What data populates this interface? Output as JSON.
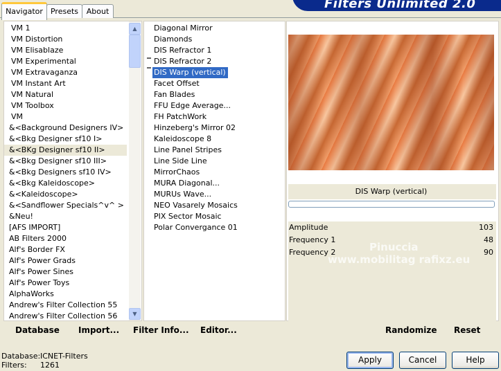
{
  "tabs": [
    {
      "label": "Navigator",
      "active": true
    },
    {
      "label": "Presets",
      "active": false
    },
    {
      "label": "About",
      "active": false
    }
  ],
  "app_title": "Filters Unlimited 2.0",
  "categories": {
    "items": [
      "VM 1",
      "VM Distortion",
      "VM Elisablaze",
      "VM Experimental",
      "VM Extravaganza",
      "VM Instant Art",
      "VM Natural",
      "VM Toolbox",
      "VM",
      "&<Background Designers IV>",
      "&<Bkg Designer sf10 I>",
      "&<BKg Designer sf10 II>",
      "&<Bkg Designer sf10 III>",
      "&<Bkg Designers sf10 IV>",
      "&<Bkg Kaleidoscope>",
      "&<Kaleidoscope>",
      "&<Sandflower Specials^v^ >",
      "&Neu!",
      "[AFS IMPORT]",
      "AB Filters 2000",
      "Alf's Border FX",
      "Alf's Power Grads",
      "Alf's Power Sines",
      "Alf's Power Toys",
      "AlphaWorks",
      "Andrew's Filter Collection 55",
      "Andrew's Filter Collection 56"
    ],
    "selected_index": 11
  },
  "filters": {
    "items": [
      "Diagonal Mirror",
      "Diamonds",
      "DIS Refractor 1",
      "DIS Refractor 2",
      "DIS Warp (vertical)",
      "Facet Offset",
      "Fan Blades",
      "FFU Edge Average...",
      "FH PatchWork",
      "Hinzeberg's Mirror 02",
      "Kaleidoscope 8",
      "Line Panel Stripes",
      "Line Side Line",
      "MirrorChaos",
      "MURA Diagonal...",
      "MURUs Wave...",
      "NEO Vasarely Mosaics",
      "PIX Sector Mosaic",
      "Polar Convergance 01"
    ],
    "selected_index": 4
  },
  "bottom_links": {
    "database": "Database",
    "import": "Import...",
    "filter_info": "Filter Info...",
    "editor": "Editor...",
    "randomize": "Randomize",
    "reset": "Reset"
  },
  "preview": {
    "filter_name": "DIS Warp (vertical)",
    "progress": 0
  },
  "parameters": [
    {
      "name": "Amplitude",
      "value": "103"
    },
    {
      "name": "Frequency 1",
      "value": "48"
    },
    {
      "name": "Frequency 2",
      "value": "90"
    }
  ],
  "watermark": {
    "line1": "Pinuccia",
    "line2": "www.mobilitag rafixz.eu"
  },
  "status": {
    "database_label": "Database:",
    "database_value": "ICNET-Filters",
    "filters_label": "Filters:",
    "filters_value": "1261"
  },
  "buttons": {
    "apply": "Apply",
    "cancel": "Cancel",
    "help": "Help"
  }
}
